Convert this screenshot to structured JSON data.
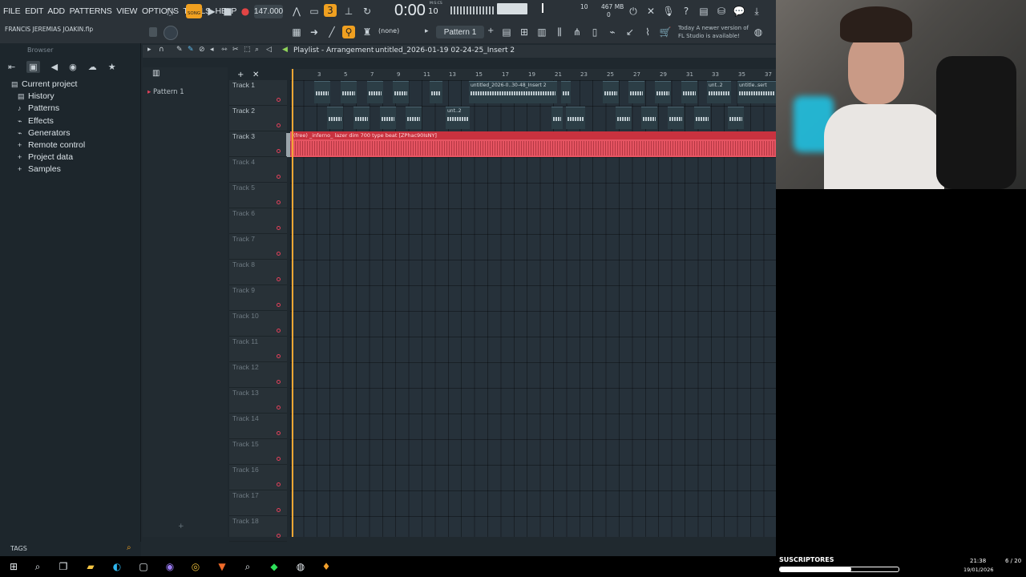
{
  "menu": [
    "FILE",
    "EDIT",
    "ADD",
    "PATTERNS",
    "VIEW",
    "OPTIONS",
    "TOOLS",
    "HELP"
  ],
  "transport": {
    "mode_label": "SONG",
    "tempo": "147.000",
    "time": "0:00",
    "time_small": "10",
    "time_unit": "M:S:CS",
    "cpu": "10",
    "memory": "467 MB",
    "voices": "0"
  },
  "project_file": "FRANCIS JEREMIAS JOAKIN.flp",
  "snap_value": "(none)",
  "pattern_selector": "Pattern 1",
  "news": {
    "line1": "Today  A newer version of",
    "line2": "FL Studio is available!"
  },
  "browser": {
    "title": "Browser",
    "root": "Current project",
    "items": [
      "History",
      "Patterns",
      "Effects",
      "Generators",
      "Remote control",
      "Project data",
      "Samples"
    ],
    "tags_label": "TAGS"
  },
  "playlist": {
    "title": "Playlist - Arrangement",
    "subtitle": "untitled_2026-01-19 02-24-25_Insert 2",
    "patterns": [
      "Pattern 1"
    ],
    "tracks": [
      "Track 1",
      "Track 2",
      "Track 3",
      "Track 4",
      "Track 5",
      "Track 6",
      "Track 7",
      "Track 8",
      "Track 9",
      "Track 10",
      "Track 11",
      "Track 12",
      "Track 13",
      "Track 14",
      "Track 15",
      "Track 16",
      "Track 17",
      "Track 18"
    ],
    "ruler": [
      "3",
      "5",
      "7",
      "9",
      "11",
      "13",
      "15",
      "17",
      "19",
      "21",
      "23",
      "25",
      "27",
      "29",
      "31",
      "33",
      "35",
      "37"
    ],
    "clip_labels": {
      "t1_a": "untitled_2026-0..30-48_Insert 2",
      "t1_b": "unt..2",
      "t1_c": "untitle..sert",
      "t2_a": "unt..2"
    },
    "audio_clip": "(free) _inferno_ lazer dim 700 type beat [ZPhac90IsNY]"
  },
  "overlay": {
    "subs_label": "SUSCRIPTORES",
    "subs_progress": 0.6
  },
  "taskbar": {
    "time": "21:38",
    "date": "19/01/2026",
    "count": "6 / 20"
  }
}
